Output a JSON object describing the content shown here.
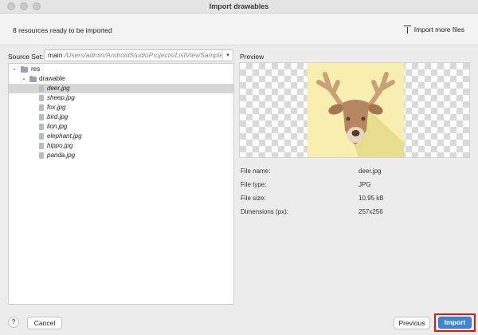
{
  "window": {
    "title": "Import drawables"
  },
  "header": {
    "ready_text": "8 resources ready to be imported",
    "import_more_label": "Import more files"
  },
  "source_set": {
    "label": "Source Set:",
    "value": "main",
    "path": "/Users/admin/AndroidStudioProjects/ListViewSample/a"
  },
  "tree": {
    "root": "res",
    "folder": "drawable",
    "files": [
      "deer.jpg",
      "sheep.jpg",
      "fox.jpg",
      "bird.jpg",
      "lion.jpg",
      "elephant.jpg",
      "hippo.jpg",
      "panda.jpg"
    ],
    "selected": "deer.jpg"
  },
  "preview": {
    "label": "Preview"
  },
  "info": {
    "file_name_label": "File name:",
    "file_name_value": "deer.jpg",
    "file_type_label": "File type:",
    "file_type_value": "JPG",
    "file_size_label": "File size:",
    "file_size_value": "10.95 kB",
    "dimensions_label": "Dimensions (px):",
    "dimensions_value": "257x256"
  },
  "footer": {
    "help_label": "?",
    "cancel_label": "Cancel",
    "previous_label": "Previous",
    "import_label": "Import"
  },
  "colors": {
    "accent": "#3f85d4",
    "highlight_border": "#d51a1a",
    "selection": "#d6d6d6",
    "preview_bg": "#f7eeb0"
  }
}
